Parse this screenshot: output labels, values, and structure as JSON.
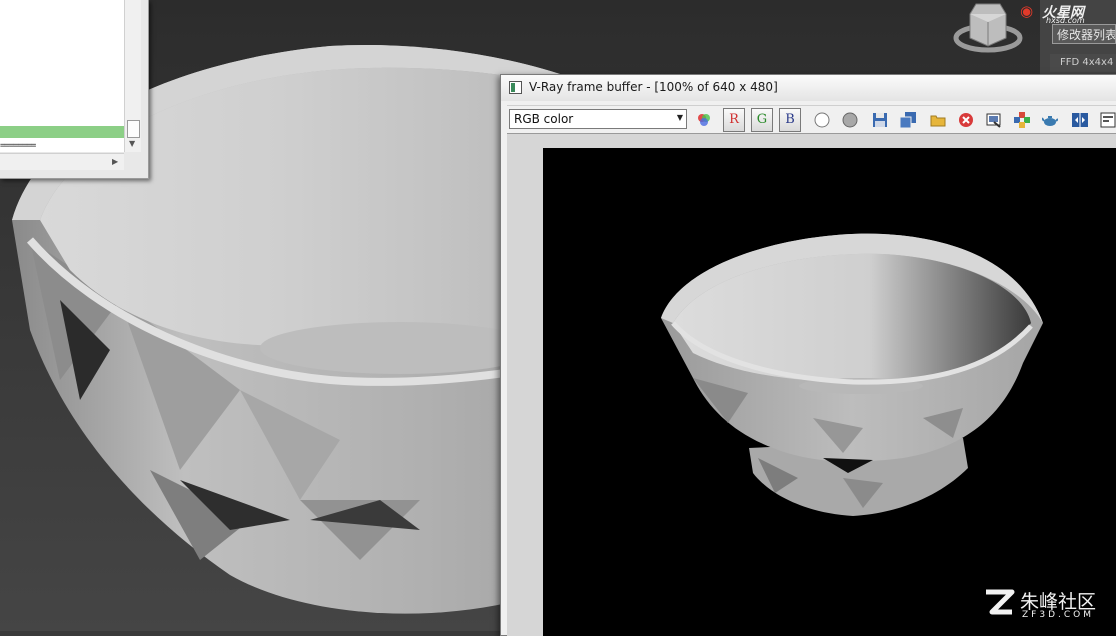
{
  "vfb": {
    "title": "V-Ray frame buffer - [100% of 640 x 480]",
    "channel": {
      "selected": "RGB color"
    },
    "channel_buttons": {
      "r": "R",
      "g": "G",
      "b": "B"
    },
    "toolbar_icons": [
      "show-corrections-icon",
      "red-channel-icon",
      "green-channel-icon",
      "blue-channel-icon",
      "white-circle-icon",
      "gray-circle-icon",
      "save-image-icon",
      "save-all-icon",
      "load-image-icon",
      "clear-image-icon",
      "copy-to-max-icon",
      "track-mouse-icon",
      "teapot-render-icon",
      "compare-ab-icon",
      "info-icon"
    ]
  },
  "command_panel": {
    "modifier_list": "修改器列表",
    "stack_item": "FFD 4x4x4"
  },
  "listener": {
    "dashes": "========"
  },
  "watermarks": {
    "top_logo_cn": "火星网",
    "top_url": "hxsd.com",
    "bottom_cn": "朱峰社区",
    "bottom_en": "ZF3D.COM"
  },
  "colors": {
    "viewport_bg": "#3a3a3a",
    "render_bg": "#000000",
    "listener_highlight": "#8ccf86"
  }
}
